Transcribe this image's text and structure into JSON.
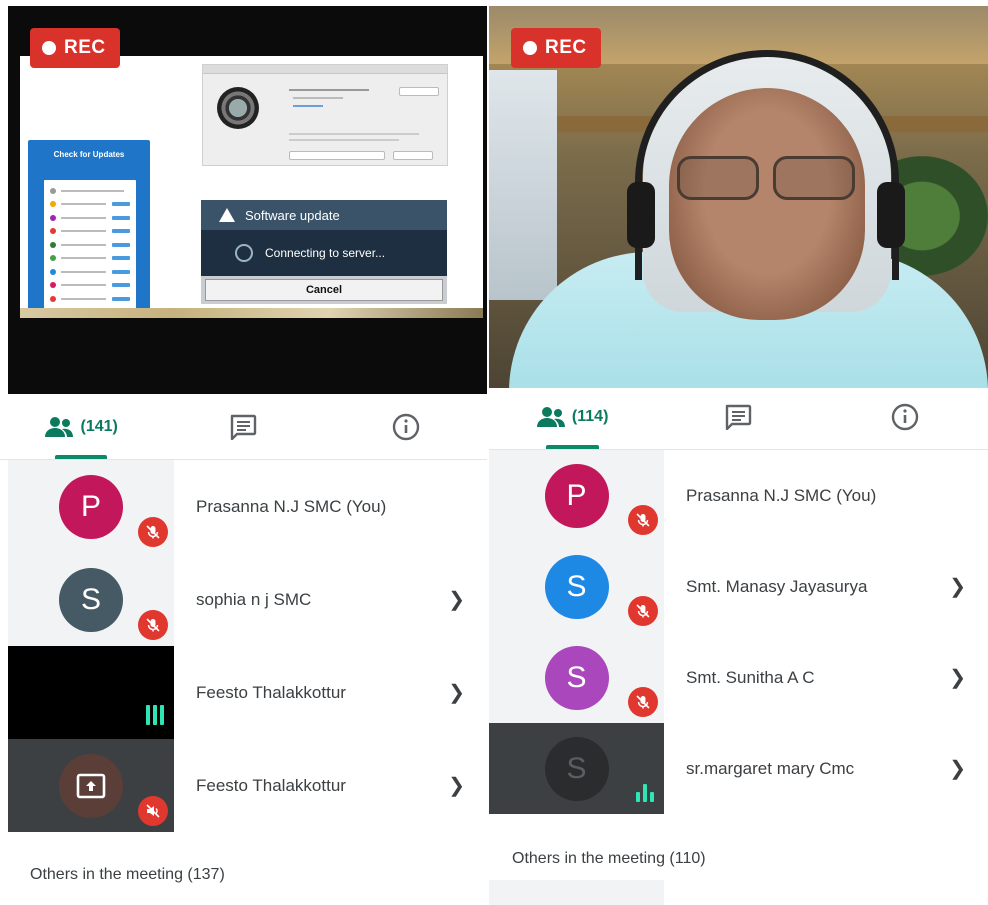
{
  "colors": {
    "rec_red": "#d9322b",
    "meet_green": "#0b7a5e",
    "mute_red": "#e0372f",
    "audio_level": "#2ee6b4"
  },
  "left_panel": {
    "rec_label": "REC",
    "screen_share": {
      "update_dialog_title": "Software update",
      "update_dialog_status": "Connecting to server...",
      "update_dialog_cancel": "Cancel",
      "check_for_updates_title": "Check for Updates"
    },
    "tabs": {
      "people_icon": "people-icon",
      "people_count": "(141)",
      "chat_icon": "chat-icon",
      "info_icon": "info-icon"
    },
    "participants": [
      {
        "initial": "P",
        "name": "Prasanna N.J SMC (You)",
        "avatar_color": "#c2185b",
        "muted": true,
        "chevron": false
      },
      {
        "initial": "S",
        "name": "sophia n j SMC",
        "avatar_color": "#455a64",
        "muted": true,
        "chevron": true
      },
      {
        "initial": "",
        "name": "Feesto Thalakkottur",
        "tile": "video-dark",
        "speaking": true,
        "chevron": true
      },
      {
        "initial": "",
        "name": "Feesto Thalakkottur",
        "tile": "presenting",
        "muted": true,
        "chevron": true
      }
    ],
    "others_label": "Others in the meeting (137)"
  },
  "right_panel": {
    "rec_label": "REC",
    "tabs": {
      "people_icon": "people-icon",
      "people_count": "(114)",
      "chat_icon": "chat-icon",
      "info_icon": "info-icon"
    },
    "participants": [
      {
        "initial": "P",
        "name": "Prasanna N.J SMC (You)",
        "avatar_color": "#c2185b",
        "muted": true,
        "chevron": false
      },
      {
        "initial": "S",
        "name": "Smt. Manasy Jayasurya",
        "avatar_color": "#1e88e5",
        "muted": true,
        "chevron": true
      },
      {
        "initial": "S",
        "name": "Smt. Sunitha A C",
        "avatar_color": "#ab47bc",
        "muted": true,
        "chevron": true
      },
      {
        "initial": "S",
        "name": "sr.margaret mary Cmc",
        "tile": "dim",
        "speaking": true,
        "chevron": true
      }
    ],
    "others_label": "Others in the meeting (110)"
  }
}
